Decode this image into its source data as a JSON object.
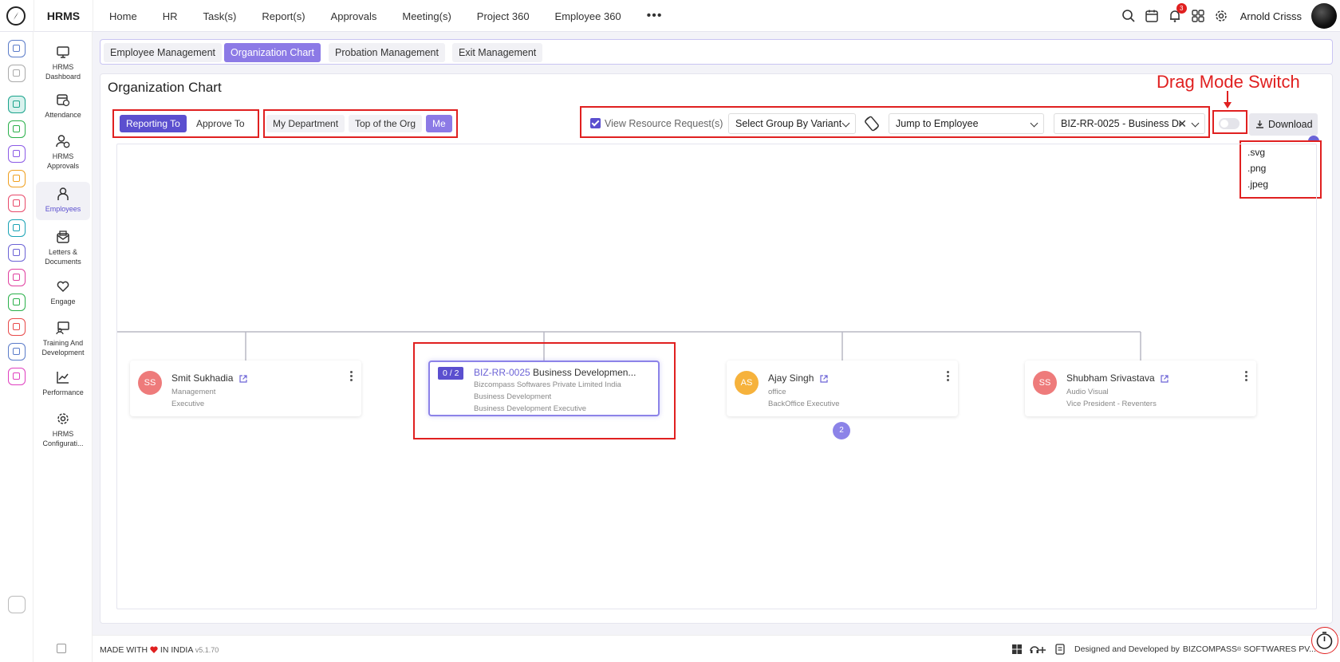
{
  "app": {
    "brand": "HRMS"
  },
  "topnav": [
    "Home",
    "HR",
    "Task(s)",
    "Report(s)",
    "Approvals",
    "Meeting(s)",
    "Project 360",
    "Employee 360"
  ],
  "topbar": {
    "notification_count": "3",
    "user_name": "Arnold Crisss"
  },
  "rail_colors": [
    "#5b7cc9",
    "#aaaaaa",
    "#1aa38c",
    "#2ab04a",
    "#8c5be6",
    "#f0a020",
    "#e84a6a",
    "#1aa3b5",
    "#6c63d6",
    "#e040a0",
    "#2ab04a",
    "#e84a4a",
    "#5b7cc9",
    "#e040c0"
  ],
  "sidebar": [
    {
      "label1": "HRMS",
      "label2": "Dashboard"
    },
    {
      "label1": "Attendance",
      "label2": ""
    },
    {
      "label1": "HRMS",
      "label2": "Approvals"
    },
    {
      "label1": "Employees",
      "label2": ""
    },
    {
      "label1": "Letters &",
      "label2": "Documents"
    },
    {
      "label1": "Engage",
      "label2": ""
    },
    {
      "label1": "Training And",
      "label2": "Development"
    },
    {
      "label1": "Performance",
      "label2": ""
    },
    {
      "label1": "HRMS",
      "label2": "Configurati..."
    }
  ],
  "tabs": [
    "Employee Management",
    "Organization Chart",
    "Probation Management",
    "Exit Management"
  ],
  "page": {
    "title": "Organization Chart",
    "annotation": "Drag Mode Switch"
  },
  "toolbar": {
    "relation": [
      "Reporting To",
      "Approve To"
    ],
    "scope": [
      "My Department",
      "Top of the Org",
      "Me"
    ],
    "view_resource": "View Resource Request(s)",
    "group_by": "Select Group By Variant",
    "jump": "Jump to Employee",
    "employee_select": "BIZ-RR-0025 - Business De",
    "download": "Download",
    "download_options": [
      ".svg",
      ".png",
      ".jpeg"
    ]
  },
  "cards": [
    {
      "initials": "SS",
      "name": "Smit Sukhadia",
      "line1": "Management",
      "line2": "Executive",
      "color": "#ee7b7b"
    },
    {
      "count": "0 / 2",
      "code": "BIZ-RR-0025",
      "title": "Business Developmen...",
      "line1": "Bizcompass Softwares Private Limited India",
      "line2": "Business Development",
      "line3": "Business Development Executive"
    },
    {
      "initials": "AS",
      "name": "Ajay Singh",
      "line1": "office",
      "line2": "BackOffice Executive",
      "color": "#f6b23c",
      "children": "2"
    },
    {
      "initials": "SS",
      "name": "Shubham Srivastava",
      "line1": "Audio Visual",
      "line2": "Vice President - Reventers",
      "color": "#ee7b7b"
    }
  ],
  "footer": {
    "made_prefix": "MADE WITH",
    "made_suffix": "IN INDIA",
    "version": "v5.1.70",
    "designed": "Designed and Developed by",
    "company": "BIZCOMPASS",
    "reg": "®",
    "company_suffix": "SOFTWARES PV..."
  }
}
